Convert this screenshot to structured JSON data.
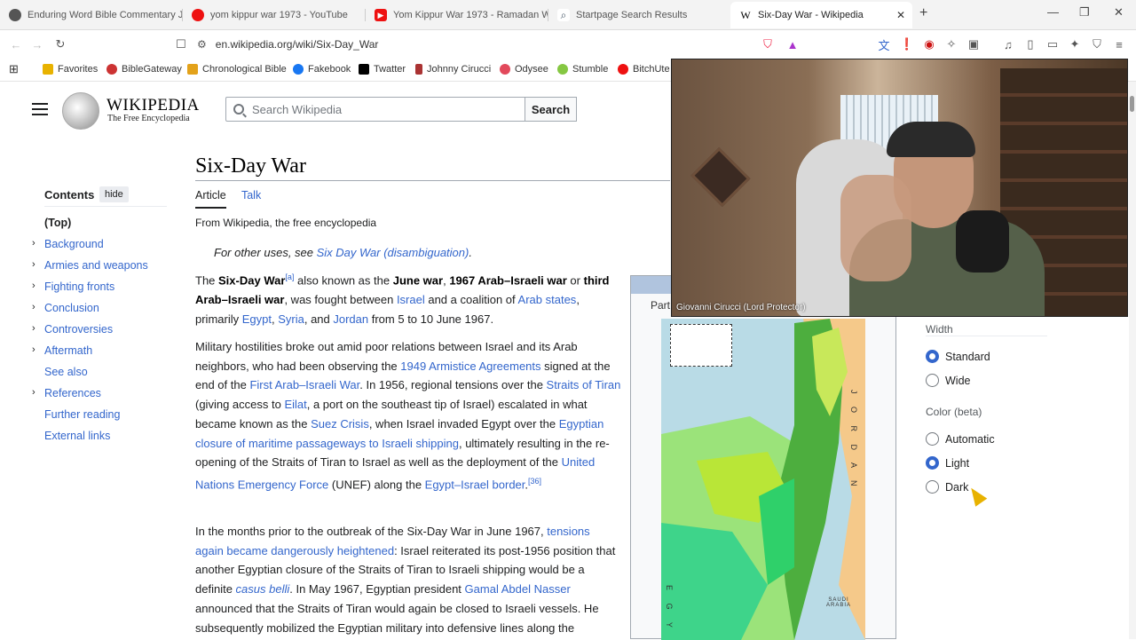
{
  "tabs": [
    {
      "label": "Enduring Word Bible Commentary Je",
      "color": "#555"
    },
    {
      "label": "yom kippur war 1973 - YouTube",
      "color": "#e11"
    },
    {
      "label": "Yom Kippur War 1973 - Ramadan Wa",
      "color": "#e11"
    },
    {
      "label": "Startpage Search Results",
      "color": "#456"
    },
    {
      "label": "Six-Day War - Wikipedia",
      "color": "#000"
    }
  ],
  "new_tab": "+",
  "url": "en.wikipedia.org/wiki/Six-Day_War",
  "bookmarks": [
    {
      "label": "Favorites",
      "color": "#e8b200"
    },
    {
      "label": "BibleGateway",
      "color": "#c33"
    },
    {
      "label": "Chronological Bible",
      "color": "#e3a21a"
    },
    {
      "label": "Fakebook",
      "color": "#1877f2"
    },
    {
      "label": "Twatter",
      "color": "#000"
    },
    {
      "label": "Johnny Cirucci",
      "color": "#a33"
    },
    {
      "label": "Odysee",
      "color": "#e2495b"
    },
    {
      "label": "Stumble",
      "color": "#85c742"
    },
    {
      "label": "BitchUte",
      "color": "#e11"
    }
  ],
  "wiki": {
    "name": "WIKIPEDIA",
    "tagline": "The Free Encyclopedia",
    "search_placeholder": "Search Wikipedia",
    "search_button": "Search",
    "title": "Six-Day War",
    "tab_article": "Article",
    "tab_talk": "Talk",
    "from": "From Wikipedia, the free encyclopedia",
    "hatnote_prefix": "For other uses, see ",
    "hatnote_link": "Six Day War (disambiguation)",
    "hatnote_suffix": ".",
    "infobox_part": "Part"
  },
  "toc": {
    "heading": "Contents",
    "hide": "hide",
    "items": [
      {
        "label": "(Top)",
        "expand": false,
        "top": true
      },
      {
        "label": "Background",
        "expand": true
      },
      {
        "label": "Armies and weapons",
        "expand": true
      },
      {
        "label": "Fighting fronts",
        "expand": true
      },
      {
        "label": "Conclusion",
        "expand": true
      },
      {
        "label": "Controversies",
        "expand": true
      },
      {
        "label": "Aftermath",
        "expand": true
      },
      {
        "label": "See also",
        "expand": false
      },
      {
        "label": "References",
        "expand": true
      },
      {
        "label": "Further reading",
        "expand": false
      },
      {
        "label": "External links",
        "expand": false
      }
    ]
  },
  "paragraphs": {
    "p1": [
      {
        "t": "The ",
        "s": "n"
      },
      {
        "t": "Six-Day War",
        "s": "b"
      },
      {
        "t": "[a]",
        "s": "sup"
      },
      {
        "t": " also known as the ",
        "s": "n"
      },
      {
        "t": "June war",
        "s": "b"
      },
      {
        "t": ", ",
        "s": "n"
      },
      {
        "t": "1967 Arab–Israeli war",
        "s": "b"
      },
      {
        "t": " or ",
        "s": "n"
      },
      {
        "t": "third Arab–Israeli war",
        "s": "b"
      },
      {
        "t": ", was fought between ",
        "s": "n"
      },
      {
        "t": "Israel",
        "s": "a"
      },
      {
        "t": " and a coalition of ",
        "s": "n"
      },
      {
        "t": "Arab states",
        "s": "a"
      },
      {
        "t": ", primarily ",
        "s": "n"
      },
      {
        "t": "Egypt",
        "s": "a"
      },
      {
        "t": ", ",
        "s": "n"
      },
      {
        "t": "Syria",
        "s": "a"
      },
      {
        "t": ", and ",
        "s": "n"
      },
      {
        "t": "Jordan",
        "s": "a"
      },
      {
        "t": " from 5 to 10 June 1967.",
        "s": "n"
      }
    ],
    "p2": [
      {
        "t": "Military hostilities broke out amid poor relations between Israel and its Arab neighbors, who had been observing the ",
        "s": "n"
      },
      {
        "t": "1949 Armistice Agreements",
        "s": "a"
      },
      {
        "t": " signed at the end of the ",
        "s": "n"
      },
      {
        "t": "First Arab–Israeli War",
        "s": "a"
      },
      {
        "t": ". In 1956, regional tensions over the ",
        "s": "n"
      },
      {
        "t": "Straits of Tiran",
        "s": "a"
      },
      {
        "t": " (giving access to ",
        "s": "n"
      },
      {
        "t": "Eilat",
        "s": "a"
      },
      {
        "t": ", a port on the southeast tip of Israel) escalated in what became known as the ",
        "s": "n"
      },
      {
        "t": "Suez Crisis",
        "s": "a"
      },
      {
        "t": ", when Israel invaded Egypt over the ",
        "s": "n"
      },
      {
        "t": "Egyptian closure of maritime passageways to Israeli shipping",
        "s": "a"
      },
      {
        "t": ", ultimately resulting in the re-opening of the Straits of Tiran to Israel as well as the deployment of the ",
        "s": "n"
      },
      {
        "t": "United Nations Emergency Force",
        "s": "a"
      },
      {
        "t": " (UNEF) along the ",
        "s": "n"
      },
      {
        "t": "Egypt–Israel border",
        "s": "a"
      },
      {
        "t": ".",
        "s": "n"
      },
      {
        "t": "[36]",
        "s": "sup"
      }
    ],
    "p3": [
      {
        "t": "In the months prior to the outbreak of the Six-Day War in June 1967, ",
        "s": "n"
      },
      {
        "t": "tensions again became dangerously heightened",
        "s": "a"
      },
      {
        "t": ": Israel reiterated its post-1956 position that another Egyptian closure of the Straits of Tiran to Israeli shipping would be a definite ",
        "s": "n"
      },
      {
        "t": "casus belli",
        "s": "ai"
      },
      {
        "t": ". In May 1967, Egyptian president ",
        "s": "n"
      },
      {
        "t": "Gamal Abdel Nasser",
        "s": "a"
      },
      {
        "t": " announced that the Straits of Tiran would again be closed to Israeli vessels. He subsequently mobilized the Egyptian military into defensive lines along the",
        "s": "n"
      }
    ]
  },
  "settings": {
    "width_heading": "Width",
    "width_options": [
      {
        "label": "Standard",
        "on": true
      },
      {
        "label": "Wide",
        "on": false
      }
    ],
    "color_heading": "Color (beta)",
    "color_options": [
      {
        "label": "Automatic",
        "on": false
      },
      {
        "label": "Light",
        "on": true
      },
      {
        "label": "Dark",
        "on": false
      }
    ]
  },
  "video": {
    "caption": "Giovanni Cirucci (Lord Protector)"
  },
  "map_labels": {
    "jordan": "J O R D A N",
    "egypt": "E G Y",
    "saudi": "SAUDI ARABIA"
  }
}
